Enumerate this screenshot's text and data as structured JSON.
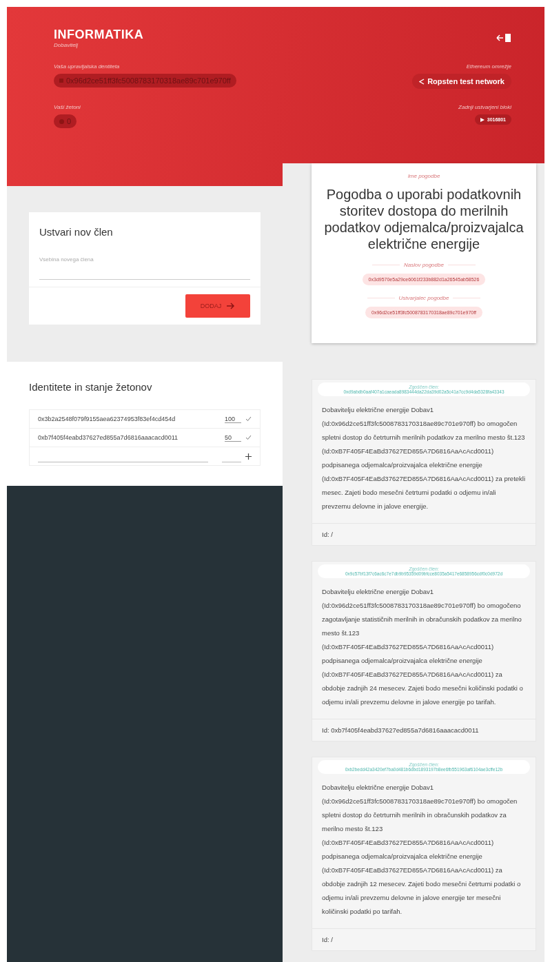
{
  "header": {
    "logo": "INFORMATIKA",
    "role": "Dobavitelj",
    "identity": {
      "label": "Vaša upravljalska dentiteta",
      "value": "0x96d2ce51ff3fc5008783170318ae89c701e970ff"
    },
    "network": {
      "label": "Ethereum omrežje",
      "value": "Ropsten test network"
    },
    "tokens": {
      "label": "Vaši žetoni",
      "value": "0"
    },
    "block": {
      "label": "Zadnji ustvarjeni bloki",
      "value": "3016801"
    }
  },
  "new_member": {
    "title": "Ustvari nov člen",
    "placeholder": "Vsebina novega člena",
    "button": "DODAJ"
  },
  "identities": {
    "title": "Identitete in stanje žetonov",
    "rows": [
      {
        "address": "0x3b2a2548f079f9155aea62374953f83ef4cd454d",
        "amount": "100"
      },
      {
        "address": "0xb7f405f4eabd37627ed855a7d6816aaacacd0011",
        "amount": "50"
      }
    ]
  },
  "contract": {
    "name_label": "Ime pogodbe",
    "title": "Pogodba o uporabi podatkovnih storitev dostopa do merilnih podatkov odjemalca/proizvajalca električne energije",
    "address_label": "Naslov pogodbe",
    "address": "0x3d9570e5a29ce6061f233b882d1a26545ab58526",
    "creator_label": "Ustvarjalec pogodbe",
    "creator": "0x96d2ce51ff3fc5008783170318ae89c701e970ff"
  },
  "members": [
    {
      "label": "Zgoščen člen:",
      "hash": "0xd9abdb0aaf407a1caeada8983444da22da39d02a5c41a7cc9d4da5328fa43343",
      "text": "Dobavitelju električne energije Dobav1 (Id:0x96d2ce51ff3fc5008783170318ae89c701e970ff) bo omogočen spletni dostop do četrturnih merilnih podatkov za merilno mesto št.123 (Id:0xB7F405F4EaBd37627ED855A7D6816AaAcAcd0011) podpisanega odjemalca/proizvajalca električne energije (Id:0xB7F405F4EaBd37627ED855A7D6816AaAcAcd0011) za pretekli mesec. Zajeti bodo mesečni četrturni podatki o odjemu in/ali prevzemu delovne in jalove energije.",
      "id": "Id: /"
    },
    {
      "label": "Zgoščen člen:",
      "hash": "0x9c57bf13f7c6ac6c7e7db9b95359d09bfcce8035a5417e6858956cdf0c0d972d",
      "text": "Dobavitelju električne energije Dobav1 (Id:0x96d2ce51ff3fc5008783170318ae89c701e970ff) bo omogočeno zagotavljanje statističnih merilnih in obračunskih podatkov za merilno mesto št.123 (Id:0xB7F405F4EaBd37627ED855A7D6816AaAcAcd0011) podpisanega odjemalca/proizvajalca električne energije (Id:0xB7F405F4EaBd37627ED855A7D6816AaAcAcd0011) za obdobje zadnjih 24 mesecev. Zajeti bodo mesečni količinski podatki o odjemu in/ali prevzemu delovne in jalove energije po tarifah.",
      "id": "Id: 0xb7f405f4eabd37627ed855a7d6816aaacacd0011"
    },
    {
      "label": "Zgoščen člen:",
      "hash": "0xb2bedd42a3420ef7ba0d481b6dbd1893197b8ee6fb551963af6104ae3cffe12b",
      "text": "Dobavitelju električne energije Dobav1 (Id:0x96d2ce51ff3fc5008783170318ae89c701e970ff) bo omogočen spletni dostop do četrturnih merilnih in obračunskih podatkov za merilno mesto št.123 (Id:0xB7F405F4EaBd37627ED855A7D6816AaAcAcd0011) podpisanega odjemalca/proizvajalca električne energije (Id:0xB7F405F4EaBd37627ED855A7D6816AaAcAcd0011) za obdobje zadnjih 12 mesecev. Zajeti bodo mesečni četrturni podatki o odjemu in/ali prevzemu delovne in jalove energije ter mesečni količinski podatki po tarifah.",
      "id": "Id: /"
    }
  ]
}
